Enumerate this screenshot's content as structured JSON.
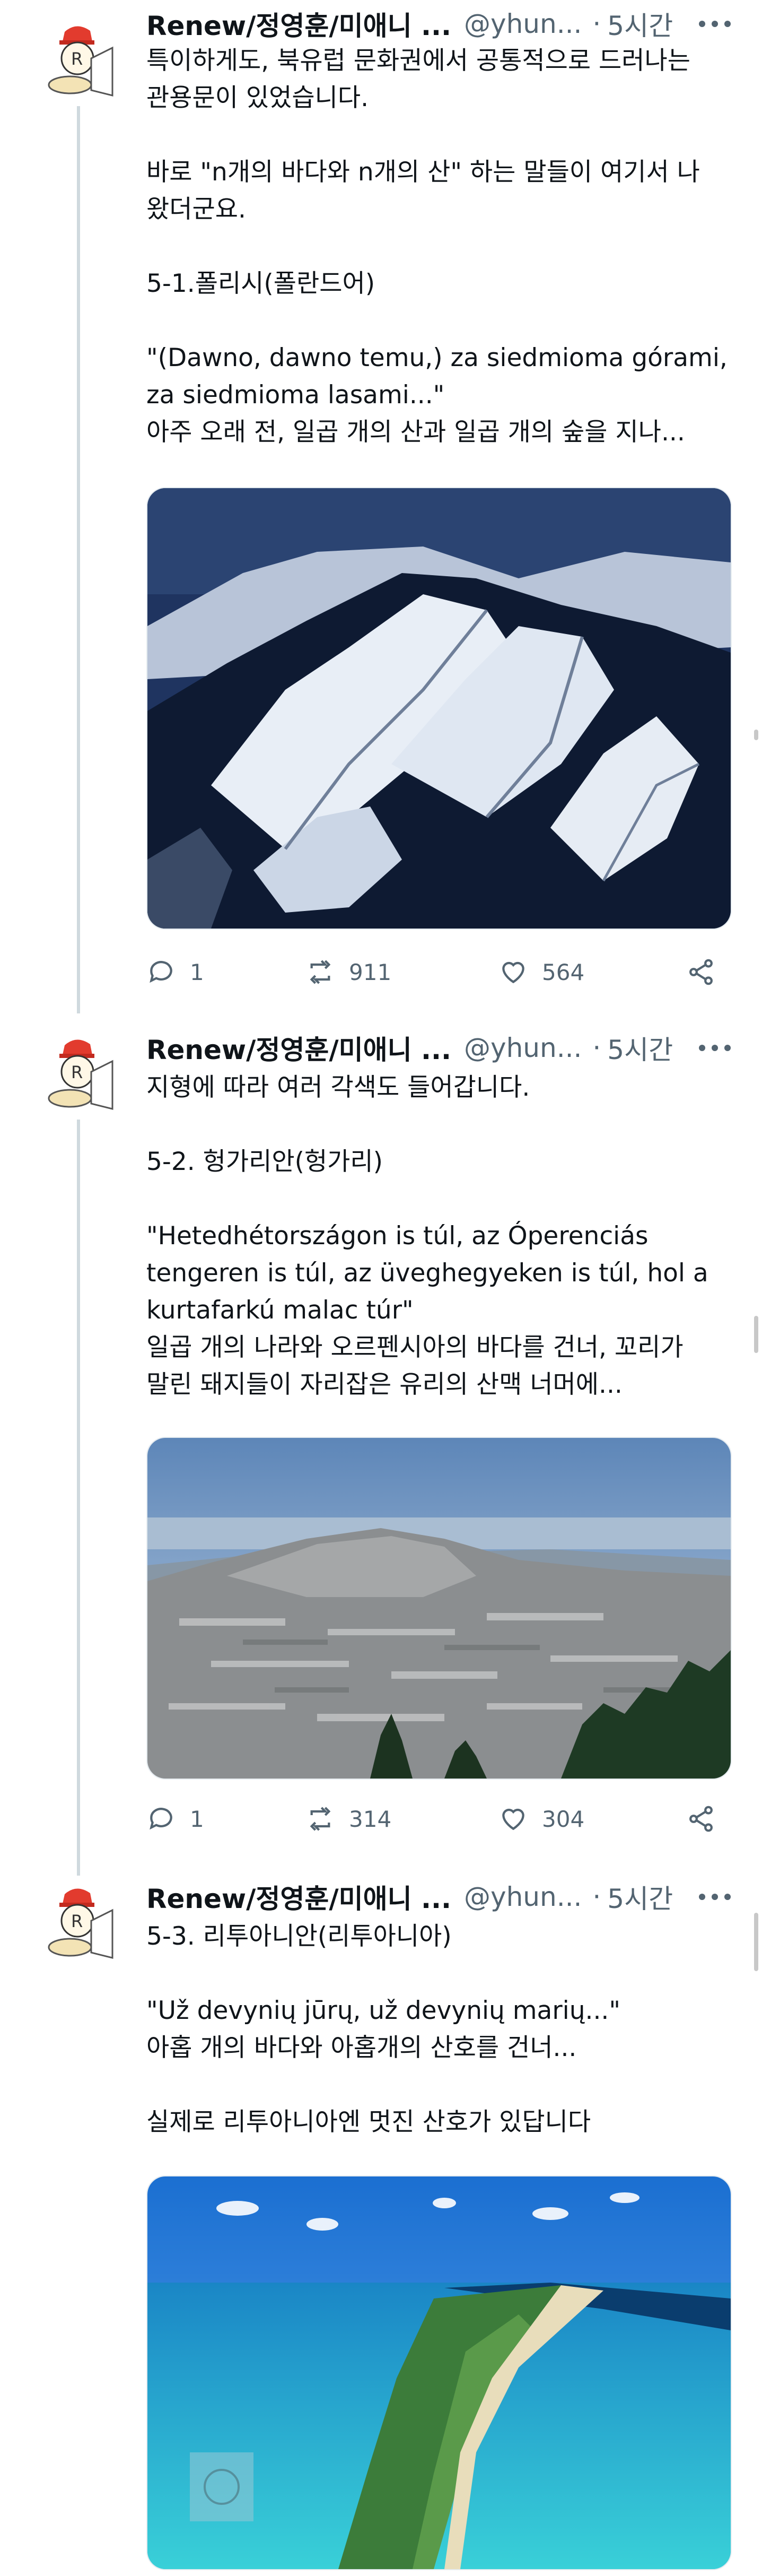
{
  "tweets": [
    {
      "author": "Renew/정영훈/미애니 ...",
      "handle": "@yhun...",
      "separator": "·",
      "time": "5시간",
      "text": "특이하게도, 북유럽 문화권에서 공통적으로 드러나는\n관용문이 있었습니다.\n\n바로 \"n개의 바다와 n개의 산\" 하는 말들이 여기서 나\n왔더군요.\n\n5-1.폴리시(폴란드어)\n\n\"(Dawno, dawno temu,) za siedmioma górami,\nza siedmioma lasami...\"\n아주 오래 전, 일곱 개의 산과 일곱 개의 숲을 지나...",
      "image": "snowy-mountain-range-aerial-photo",
      "replies": "1",
      "retweets": "911",
      "likes": "564"
    },
    {
      "author": "Renew/정영훈/미애니 ...",
      "handle": "@yhun...",
      "separator": "·",
      "time": "5시간",
      "text": "지형에 따라 여러 각색도 들어갑니다.\n\n5-2. 헝가리안(헝가리)\n\n\"Hetedhétországon is túl, az Óperenciás\ntengeren is túl, az üveghegyeken is túl, hol a\nkurtafarkú malac túr\"\n일곱 개의 나라와 오르펜시아의 바다를 건너, 꼬리가\n말린 돼지들이 자리잡은 유리의 산맥 너머에...",
      "image": "volcanic-plateau-landscape-photo",
      "replies": "1",
      "retweets": "314",
      "likes": "304"
    },
    {
      "author": "Renew/정영훈/미애니 ...",
      "handle": "@yhun...",
      "separator": "·",
      "time": "5시간",
      "text": "5-3. 리투아니안(리투아니아)\n\n\"Už devynių jūrų, už devynių marių...\"\n아홉 개의 바다와 아홉개의 산호를 건너...\n\n실제로 리투아니아엔 멋진 산호가 있답니다",
      "image": "sandy-spit-lagoon-aerial-photo"
    }
  ],
  "colors": {
    "text": "#0f1419",
    "secondary": "#536471",
    "thread_line": "#cfd9de"
  }
}
